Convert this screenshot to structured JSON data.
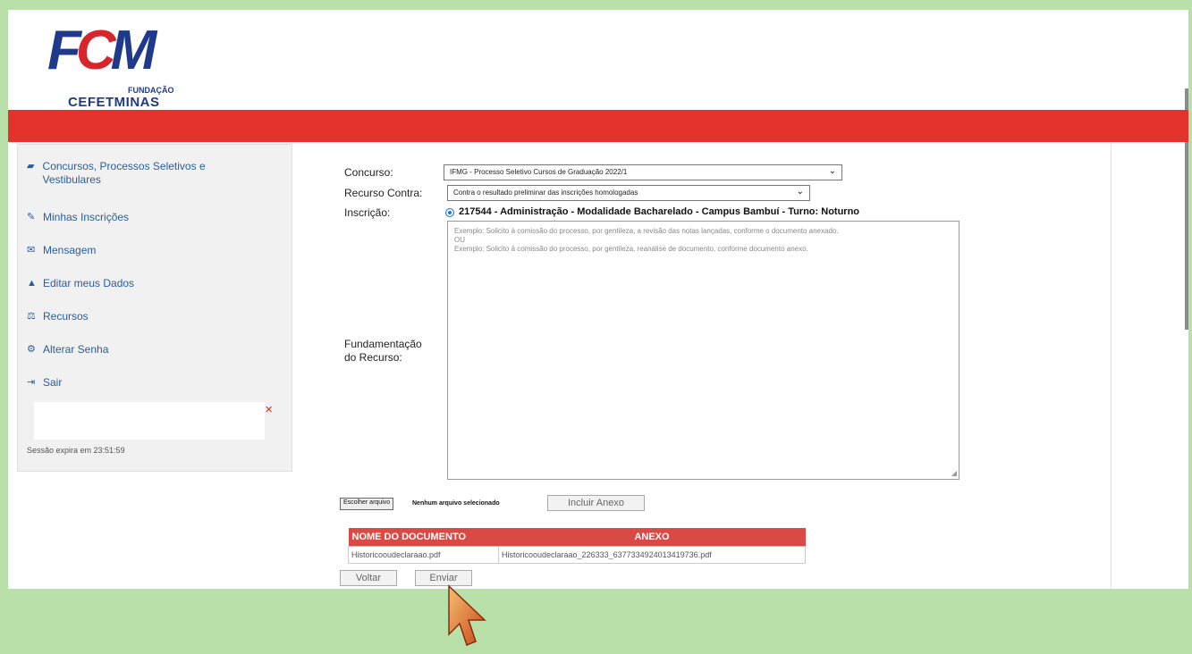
{
  "logo": {
    "main": "FCM",
    "sub1": "FUNDAÇÃO",
    "sub2": "CEFETMINAS"
  },
  "sidebar": {
    "items": [
      {
        "icon": "folder-icon",
        "label": "Concursos, Processos Seletivos e Vestibulares"
      },
      {
        "icon": "edit-icon",
        "label": "Minhas Inscrições"
      },
      {
        "icon": "envelope-icon",
        "label": "Mensagem"
      },
      {
        "icon": "user-icon",
        "label": "Editar meus Dados"
      },
      {
        "icon": "gavel-icon",
        "label": "Recursos"
      },
      {
        "icon": "gear-icon",
        "label": "Alterar Senha"
      },
      {
        "icon": "sign-out-icon",
        "label": "Sair"
      }
    ],
    "session": "Sessão expira em 23:51:59"
  },
  "form": {
    "concurso_label": "Concurso:",
    "concurso_value": "IFMG - Processo Seletivo Cursos de Graduação 2022/1",
    "recurso_label": "Recurso Contra:",
    "recurso_value": "Contra o resultado preliminar das inscrições homologadas",
    "inscricao_label": "Inscrição:",
    "inscricao_value": "217544 - Administração - Modalidade Bacharelado - Campus Bambuí - Turno: Noturno",
    "fundamentacao_label_1": "Fundamentação",
    "fundamentacao_label_2": "do Recurso:",
    "placeholder_1": "Exemplo: Solicito à comissão do processo, por gentileza, a revisão das notas lançadas, conforme o documento anexado.",
    "placeholder_2": "OU",
    "placeholder_3": "Exemplo: Solicito à comissão do processo, por gentileza, reanálise de documento, conforme documento anexo."
  },
  "upload": {
    "choose_label": "Escolher arquivo",
    "status": "Nenhum arquivo selecionado",
    "add_label": "Incluir Anexo"
  },
  "documents": {
    "headers": [
      "NOME DO DOCUMENTO",
      "ANEXO"
    ],
    "rows": [
      [
        "Historicooudeclaraao.pdf",
        "Historicooudeclaraao_226333_6377334924013419736.pdf"
      ]
    ]
  },
  "actions": {
    "back_label": "Voltar",
    "send_label": "Enviar"
  },
  "colors": {
    "accent_red": "#e5322d",
    "link_blue": "#2a5d9a",
    "background_green": "#b9e0a9"
  }
}
